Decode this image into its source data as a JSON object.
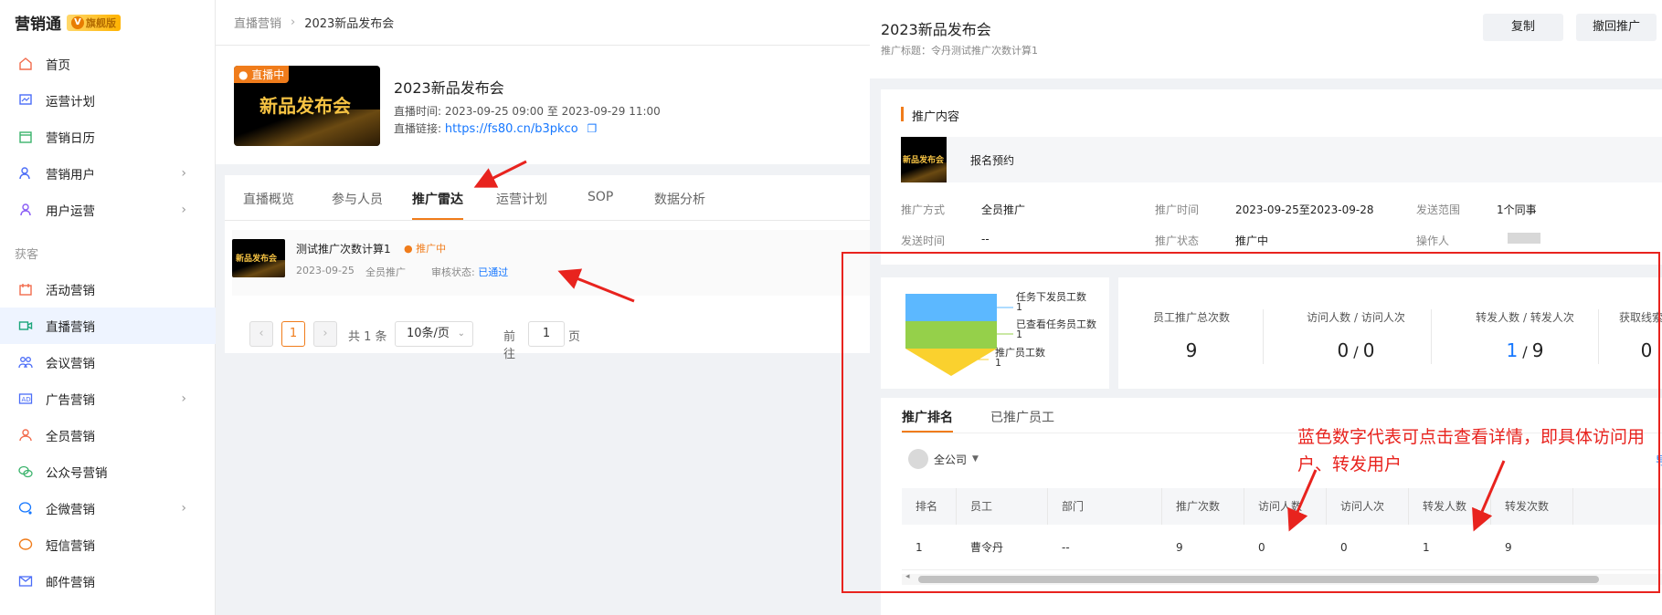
{
  "sidebar": {
    "brand": "营销通",
    "badge": "旗舰版",
    "section_label": "获客",
    "items": [
      {
        "label": "首页"
      },
      {
        "label": "运营计划"
      },
      {
        "label": "营销日历"
      },
      {
        "label": "营销用户"
      },
      {
        "label": "用户运营"
      },
      {
        "label": "活动营销"
      },
      {
        "label": "直播营销"
      },
      {
        "label": "会议营销"
      },
      {
        "label": "广告营销"
      },
      {
        "label": "全员营销"
      },
      {
        "label": "公众号营销"
      },
      {
        "label": "企微营销"
      },
      {
        "label": "短信营销"
      },
      {
        "label": "邮件营销"
      }
    ]
  },
  "breadcrumb": {
    "parent": "直播营销",
    "current": "2023新品发布会"
  },
  "live": {
    "cover_tag": "直播中",
    "cover_text": "新品发布会",
    "title": "2023新品发布会",
    "time_label": "直播时间:",
    "time_value": "2023-09-25 09:00 至 2023-09-29 11:00",
    "link_label": "直播链接:",
    "link_value": "https://fs80.cn/b3pkco"
  },
  "tabs": [
    "直播概览",
    "参与人员",
    "推广雷达",
    "运营计划",
    "SOP",
    "数据分析"
  ],
  "promo_item": {
    "name": "测试推广次数计算1",
    "status": "推广中",
    "date": "2023-09-25",
    "scope": "全员推广",
    "review_label": "审核状态:",
    "review_value": "已通过",
    "cover_text": "新品发布会"
  },
  "pager": {
    "current": "1",
    "total": "共 1 条",
    "page_size": "10条/页",
    "goto_label": "前往",
    "goto_value": "1",
    "page_suffix": "页"
  },
  "panel": {
    "title": "2023新品发布会",
    "subtitle": "推广标题：令丹测试推广次数计算1",
    "copy_button": "复制",
    "withdraw_button": "撤回推广",
    "content_section": "推广内容",
    "content_item": "报名预约",
    "content_cover": "新品发布会",
    "fields": [
      {
        "label": "推广方式",
        "value": "全员推广"
      },
      {
        "label": "推广时间",
        "value": "2023-09-25至2023-09-28"
      },
      {
        "label": "发送范围",
        "value": "1个同事"
      },
      {
        "label": "发送时间",
        "value": "--"
      },
      {
        "label": "推广状态",
        "value": "推广中"
      },
      {
        "label": "操作人",
        "value": ""
      }
    ]
  },
  "funnel": {
    "stages": [
      {
        "label": "任务下发员工数",
        "value": "1",
        "color": "#5cb8ff"
      },
      {
        "label": "已查看任务员工数",
        "value": "1",
        "color": "#95d04a"
      },
      {
        "label": "推广员工数",
        "value": "1",
        "color": "#fad12e"
      }
    ]
  },
  "stats": [
    {
      "label": "员工推广总次数",
      "value": "9"
    },
    {
      "label": "访问人数 / 访问人次",
      "value_a": "0",
      "sep": " / ",
      "value_b": "0"
    },
    {
      "label": "转发人数 / 转发人次",
      "value_a": "1",
      "sep": " / ",
      "value_b": "9"
    },
    {
      "label": "获取线索数",
      "value": "0"
    }
  ],
  "rank": {
    "tabs": [
      "推广排名",
      "已推广员工"
    ],
    "company": "全公司",
    "export": "导",
    "columns": [
      "排名",
      "员工",
      "部门",
      "推广次数",
      "访问人数",
      "访问人次",
      "转发人数",
      "转发次数"
    ],
    "rows": [
      [
        "1",
        "曹令丹",
        "--",
        "9",
        "0",
        "0",
        "1",
        "9"
      ]
    ]
  },
  "annotation": "蓝色数字代表可点击查看详情，即具体访问用户、转发用户",
  "colors": {
    "accent": "#f07c1b",
    "link": "#1677ff",
    "annotation": "#e8231e"
  }
}
